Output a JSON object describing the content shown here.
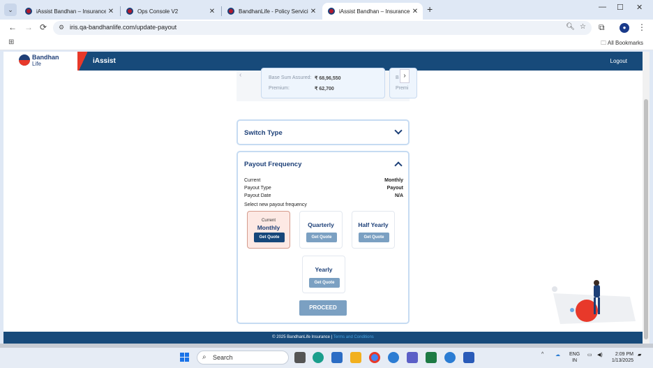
{
  "browser": {
    "tabs": [
      {
        "title": "iAssist Bandhan – Insurance Se",
        "active": false
      },
      {
        "title": "Ops Console V2",
        "active": false
      },
      {
        "title": "BandhanLife - Policy Servicing",
        "active": false
      },
      {
        "title": "iAssist Bandhan – Insurance Se",
        "active": true
      }
    ],
    "url": "iris.qa-bandhanlife.com/update-payout",
    "all_bookmarks": "All Bookmarks"
  },
  "header": {
    "logo_line1": "Bandhan",
    "logo_line2": "Life",
    "app_name": "iAssist",
    "logout": "Logout"
  },
  "policy_card": {
    "base_sum_label": "Base Sum Assured:",
    "base_sum_value": "₹ 68,96,550",
    "premium_label": "Premium:",
    "premium_value": "₹ 62,700",
    "next_base_label": "B",
    "next_premium_label": "Premi"
  },
  "switch_type": {
    "title": "Switch Type"
  },
  "payout_frequency": {
    "title": "Payout Frequency",
    "current_label": "Current",
    "current_value": "Monthly",
    "payout_type_label": "Payout Type",
    "payout_type_value": "Payout",
    "payout_date_label": "Payout Date",
    "payout_date_value": "N/A",
    "select_label": "Select new payout frequency",
    "options": [
      {
        "caption": "Current",
        "name": "Monthly",
        "button": "Get Quote"
      },
      {
        "caption": "",
        "name": "Quarterly",
        "button": "Get Quote"
      },
      {
        "caption": "",
        "name": "Half Yearly",
        "button": "Get Quote"
      },
      {
        "caption": "",
        "name": "Yearly",
        "button": "Get Quote"
      }
    ],
    "proceed": "PROCEED"
  },
  "footer": {
    "copyright": "© 2025 BandhanLife Insurance |",
    "terms": "Terms and Conditions"
  },
  "taskbar": {
    "search": "Search",
    "lang1": "ENG",
    "lang2": "IN",
    "time": "2:09 PM",
    "date": "1/13/2025"
  },
  "colors": {
    "brand_navy": "#174a7a",
    "brand_red": "#e8392a",
    "button_muted": "#7ba0c2"
  }
}
